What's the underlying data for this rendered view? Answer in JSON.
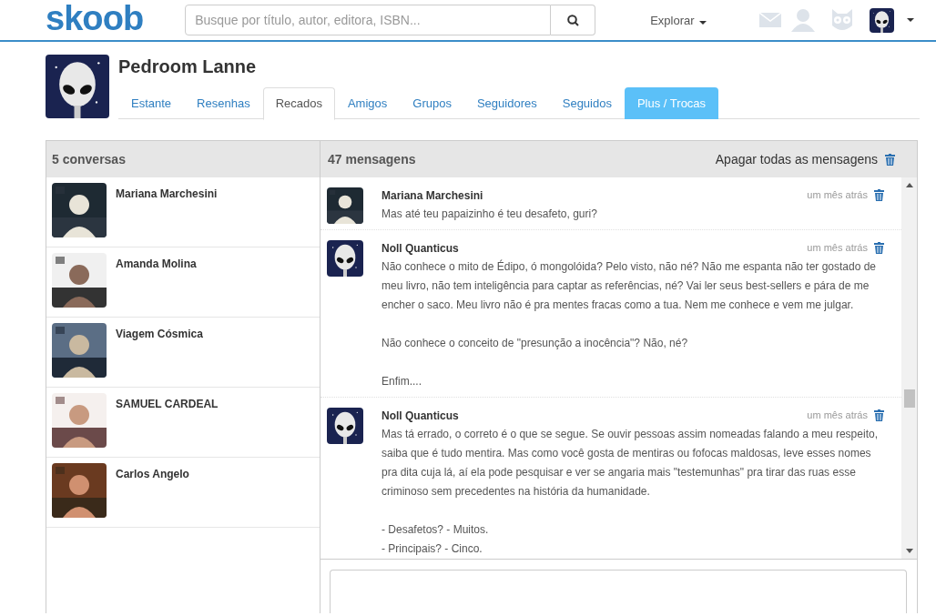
{
  "header": {
    "logo": "skoob",
    "search": {
      "placeholder": "Busque por título, autor, editora, ISBN..."
    },
    "explore": "Explorar"
  },
  "profile": {
    "name": "Pedroom Lanne"
  },
  "tabs": [
    {
      "label": "Estante",
      "selected": false,
      "kind": "plain"
    },
    {
      "label": "Resenhas",
      "selected": false,
      "kind": "plain"
    },
    {
      "label": "Recados",
      "selected": true,
      "kind": "plain"
    },
    {
      "label": "Amigos",
      "selected": false,
      "kind": "plain"
    },
    {
      "label": "Grupos",
      "selected": false,
      "kind": "plain"
    },
    {
      "label": "Seguidores",
      "selected": false,
      "kind": "plain"
    },
    {
      "label": "Seguidos",
      "selected": false,
      "kind": "plain"
    },
    {
      "label": "Plus / Trocas",
      "selected": false,
      "kind": "promo"
    }
  ],
  "conversations": {
    "title": "5 conversas",
    "items": [
      {
        "name": "Mariana Marchesini"
      },
      {
        "name": "Amanda Molina"
      },
      {
        "name": "Viagem Cósmica"
      },
      {
        "name": "SAMUEL CARDEAL"
      },
      {
        "name": "Carlos Angelo"
      }
    ]
  },
  "messages": {
    "title": "47 mensagens",
    "delete_all": "Apagar todas as mensagens",
    "items": [
      {
        "author": "Mariana Marchesini",
        "time": "um mês atrás",
        "paragraphs": [
          [
            "Mas até teu papaizinho é teu desafeto, guri?"
          ]
        ]
      },
      {
        "author": "Noll Quanticus",
        "time": "um mês atrás",
        "paragraphs": [
          [
            "Não conhece o mito de Édipo, ó mongolóida? Pelo visto, não né? Não me espanta não ter gostado de meu livro, não tem inteligência para captar as referências, né? Vai ler seus best-sellers e pára de me encher o saco. Meu livro não é pra mentes fracas como a tua. Nem me conhece e vem me julgar."
          ],
          [
            "Não conhece o conceito de \"presunção a inocência\"? Não, né?"
          ],
          [
            "Enfim...."
          ]
        ]
      },
      {
        "author": "Noll Quanticus",
        "time": "um mês atrás",
        "paragraphs": [
          [
            "Mas tá errado, o correto é o que se segue. Se ouvir pessoas assim nomeadas falando a meu respeito, saiba que é tudo mentira. Mas como você gosta de mentiras ou fofocas maldosas, leve esses nomes pra dita cuja lá, aí ela pode pesquisar e ver se angaria mais \"testemunhas\" pra tirar das ruas esse criminoso sem precedentes na história da humanidade."
          ],
          [
            "- Desafetos? - Muitos.",
            "- Principais? - Cinco."
          ]
        ]
      }
    ]
  }
}
